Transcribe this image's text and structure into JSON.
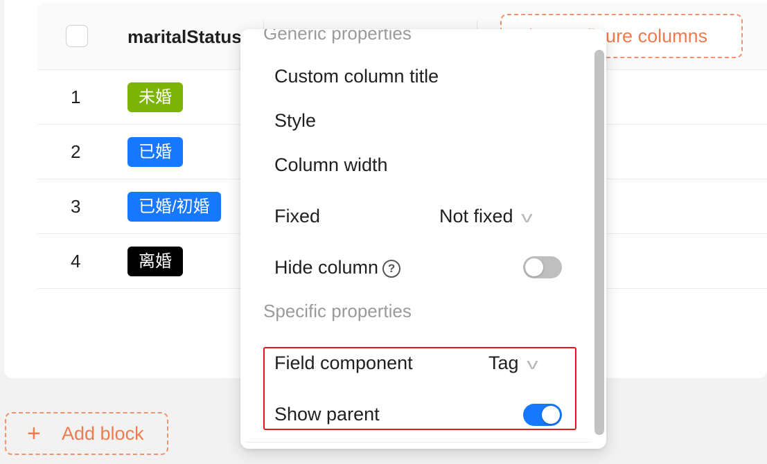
{
  "table": {
    "header": {
      "column_title": "maritalStatus",
      "configure_button_label": "Configure columns"
    },
    "rows": [
      {
        "index": "1",
        "tag": "未婚",
        "tag_color": "#7cb305"
      },
      {
        "index": "2",
        "tag": "已婚",
        "tag_color": "#1677ff"
      },
      {
        "index": "3",
        "tag": "已婚/初婚",
        "tag_color": "#1677ff"
      },
      {
        "index": "4",
        "tag": "离婚",
        "tag_color": "#000000"
      }
    ]
  },
  "add_block": {
    "label": "Add block"
  },
  "menu": {
    "generic_title": "Generic properties",
    "items": {
      "custom_title": "Custom column title",
      "style": "Style",
      "column_width": "Column width",
      "fixed": "Fixed",
      "fixed_value": "Not fixed",
      "hide_column": "Hide column",
      "hide_column_on": false
    },
    "specific_title": "Specific properties",
    "specific": {
      "field_component": "Field component",
      "field_component_value": "Tag",
      "show_parent": "Show parent",
      "show_parent_on": true
    }
  },
  "colors": {
    "accent": "#ee7b4f",
    "toggle_on": "#1677ff",
    "highlight": "#e5161d"
  }
}
